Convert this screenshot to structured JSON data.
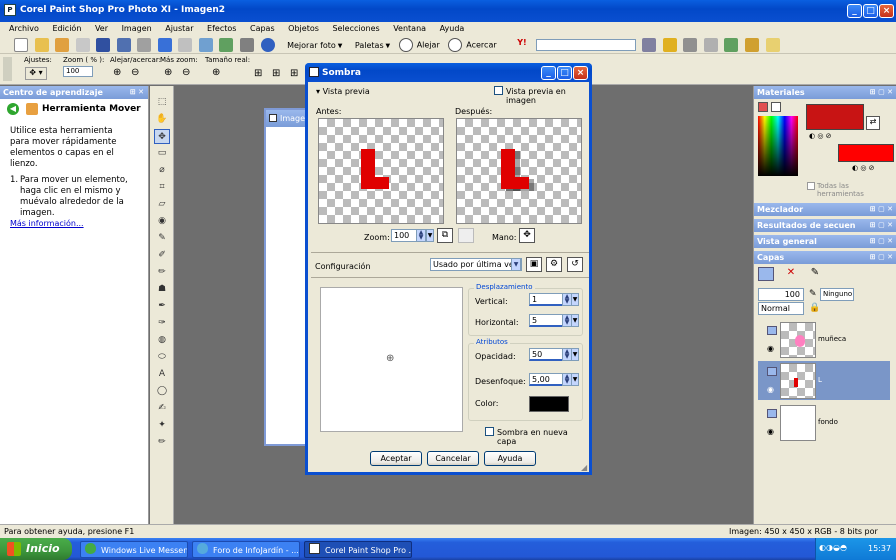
{
  "app": {
    "title": "Corel Paint Shop Pro Photo XI - Imagen2"
  },
  "menu": [
    "Archivo",
    "Edición",
    "Ver",
    "Imagen",
    "Ajustar",
    "Efectos",
    "Capas",
    "Objetos",
    "Selecciones",
    "Ventana",
    "Ayuda"
  ],
  "toolbar": {
    "enhance_label": "Mejorar foto",
    "palettes_label": "Paletas",
    "zoom_out": "Alejar",
    "zoom_in": "Acercar"
  },
  "tool_options": {
    "presets": "Ajustes:",
    "zoom_label": "Zoom ( % ):",
    "zoom_value": "100",
    "zoom_out": "Alejar/acercar:",
    "more_zoom": "Más zoom:",
    "real_size": "Tamaño real:"
  },
  "learning": {
    "header": "Centro de aprendizaje",
    "title": "Herramienta Mover",
    "intro": "Utilice esta herramienta para mover rápidamente elementos o capas en el lienzo.",
    "step1": "Para mover un elemento, haga clic en el mismo y muévalo alrededor de la imagen.",
    "more": "Más información..."
  },
  "doc_window": {
    "title": "Imagen"
  },
  "dialog": {
    "title": "Sombra",
    "preview_toggle": "Vista previa",
    "preview_in_image": "Vista previa en imagen",
    "before": "Antes:",
    "after": "Después:",
    "zoom_label": "Zoom:",
    "zoom_value": "100",
    "hand_label": "Mano:",
    "config_label": "Configuración",
    "config_value": "Usado por última vez",
    "offset_group": "Desplazamiento",
    "vertical_label": "Vertical:",
    "vertical_value": "1",
    "horizontal_label": "Horizontal:",
    "horizontal_value": "5",
    "attributes_group": "Atributos",
    "opacity_label": "Opacidad:",
    "opacity_value": "50",
    "blur_label": "Desenfoque:",
    "blur_value": "5,00",
    "color_label": "Color:",
    "shadow_color": "#000000",
    "new_layer_label": "Sombra en nueva capa",
    "accept": "Aceptar",
    "cancel": "Cancelar",
    "help": "Ayuda"
  },
  "right_panels": {
    "materials": "Materiales",
    "all_tools": "Todas las herramientas",
    "mixer": "Mezclador",
    "results": "Resultados de secuen",
    "overview": "Vista general",
    "layers": "Capas",
    "opacity_value": "100",
    "blend": "Normal",
    "none_label": "Ninguno",
    "layer_names": [
      "muñeca",
      "L",
      "fondo"
    ],
    "fg_color": "#c81414",
    "bg_color": "#ff0000"
  },
  "status": {
    "help": "Para obtener ayuda, presione F1",
    "image_info": "Imagen: 450 x 450 x RGB - 8 bits por canal"
  },
  "taskbar": {
    "start": "Inicio",
    "items": [
      "Windows Live Messen...",
      "Foro de InfoJardín - ...",
      "Corel Paint Shop Pro ..."
    ],
    "clock": "15:37"
  }
}
